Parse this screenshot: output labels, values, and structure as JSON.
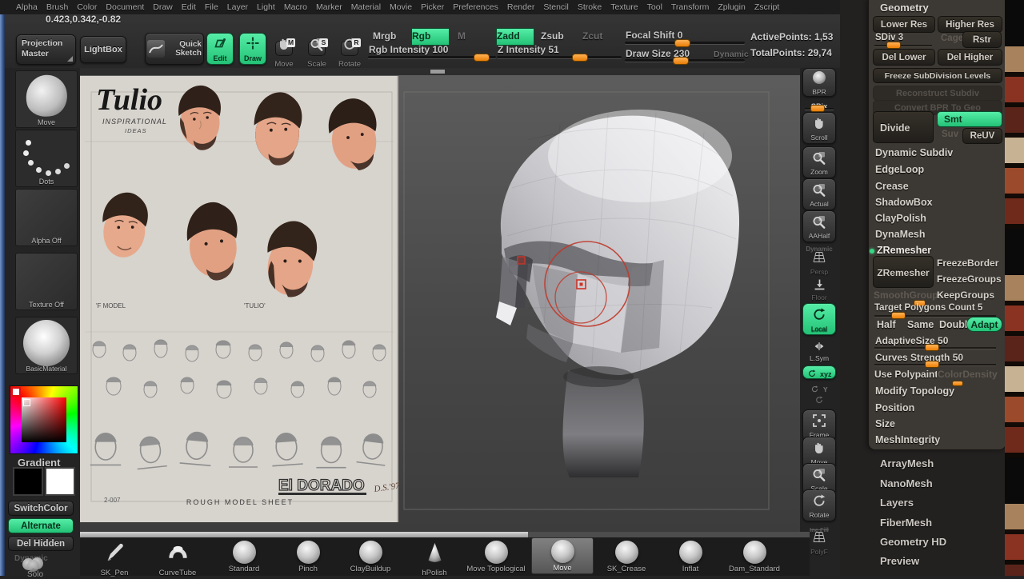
{
  "menu": {
    "items": [
      "Alpha",
      "Brush",
      "Color",
      "Document",
      "Draw",
      "Edit",
      "File",
      "Layer",
      "Light",
      "Macro",
      "Marker",
      "Material",
      "Movie",
      "Picker",
      "Preferences",
      "Render",
      "Stencil",
      "Stroke",
      "Texture",
      "Tool",
      "Transform",
      "Zplugin",
      "Zscript"
    ]
  },
  "status": {
    "coords": "0.423,0.342,-0.82"
  },
  "toolbar": {
    "projection_master": "Projection Master",
    "lightbox": "LightBox",
    "quick_sketch": "Quick Sketch",
    "edit": "Edit",
    "draw": "Draw",
    "move": "Move",
    "scale": "Scale",
    "rotate": "Rotate",
    "mrgb": "Mrgb",
    "rgb": "Rgb",
    "m": "M",
    "zadd": "Zadd",
    "zsub": "Zsub",
    "zcut": "Zcut",
    "rgb_intensity": {
      "label": "Rgb Intensity",
      "value": 100
    },
    "z_intensity": {
      "label": "Z Intensity",
      "value": 51
    },
    "focal_shift": {
      "label": "Focal Shift",
      "value": 0
    },
    "draw_size": {
      "label": "Draw Size",
      "value": 230
    },
    "dynamic": "Dynamic",
    "active_points": "ActivePoints: 1,53",
    "total_points": "TotalPoints: 29,74"
  },
  "left_tray": {
    "move_thumb": "Move",
    "stroke_thumb": "Dots",
    "alpha_thumb": "Alpha  Off",
    "texture_thumb": "Texture  Off",
    "material_thumb": "BasicMaterial",
    "gradient": "Gradient",
    "switch_color": "SwitchColor",
    "alternate": "Alternate",
    "del_hidden": "Del Hidden",
    "dynamic": "Dynamic",
    "solo": "Solo"
  },
  "canvas": {
    "sheet": {
      "title": "Tulio",
      "subtitle1": "INSPIRATIONAL",
      "subtitle2": "IDEAS",
      "label_left": "'F MODEL",
      "label_right": "'TULIO'",
      "page_number": "2-007",
      "caption": "ROUGH MODEL SHEET",
      "logo": "El DORADO",
      "signature": "D.S.'97"
    }
  },
  "right_shelf": {
    "bpr": "BPR",
    "spix": "SPix",
    "scroll": "Scroll",
    "zoom": "Zoom",
    "actual": "Actual",
    "aahalf": "AAHalf",
    "dynamic": "Dynamic",
    "persp": "Persp",
    "floor": "Floor",
    "local": "Local",
    "lsym": "L.Sym",
    "xyz": "xyz",
    "y": "Y",
    "frame": "Frame",
    "move": "Move",
    "scale": "Scale",
    "rotate": "Rotate",
    "ine_fill": "Ine Fill",
    "polyf": "PolyF"
  },
  "geometry": {
    "title": "Geometry",
    "lower_res": "Lower Res",
    "higher_res": "Higher Res",
    "sdiv": {
      "label": "SDiv",
      "value": 3
    },
    "cage": "Cage",
    "rstr": "Rstr",
    "del_lower": "Del Lower",
    "del_higher": "Del Higher",
    "freeze_sub": "Freeze SubDivision Levels",
    "reconstruct": "Reconstruct Subdiv",
    "convert_bpr": "Convert BPR To Geo",
    "divide": "Divide",
    "smt": "Smt",
    "suv": "Suv",
    "reuv": "ReUV",
    "dynamic_subdiv": "Dynamic Subdiv",
    "edgeloop": "EdgeLoop",
    "crease": "Crease",
    "shadowbox": "ShadowBox",
    "claypolish": "ClayPolish",
    "dynamesh": "DynaMesh",
    "zremesher": "ZRemesher",
    "zremesher_button": "ZRemesher",
    "freeze_border": "FreezeBorder",
    "freeze_groups": "FreezeGroups",
    "smooth_groups": "SmoothGroups",
    "keep_groups": "KeepGroups",
    "target_polygons": {
      "label": "Target Polygons Count",
      "value": 5
    },
    "half": "Half",
    "same": "Same",
    "double": "Double",
    "adapt": "Adapt",
    "adaptive_size": {
      "label": "AdaptiveSize",
      "value": 50
    },
    "curves_strength": {
      "label": "Curves Strength",
      "value": 50
    },
    "use_polypaint": "Use Polypaint",
    "color_density": "ColorDensity",
    "modify_topology": "Modify Topology",
    "position": "Position",
    "size": "Size",
    "mesh_integrity": "MeshIntegrity"
  },
  "tool_sections": {
    "items": [
      "ArrayMesh",
      "NanoMesh",
      "Layers",
      "FiberMesh",
      "Geometry HD",
      "Preview"
    ]
  },
  "bottom_tray": {
    "brushes": [
      "SK_Pen",
      "CurveTube",
      "Standard",
      "Pinch",
      "ClayBuildup",
      "hPolish",
      "Move Topological",
      "Move",
      "SK_Crease",
      "Inflat",
      "Dam_Standard"
    ],
    "selected": "Move"
  },
  "colors": {
    "accent_green": "#3ce08e",
    "accent_orange": "#ec7f07",
    "cursor_red": "#c0392b"
  }
}
